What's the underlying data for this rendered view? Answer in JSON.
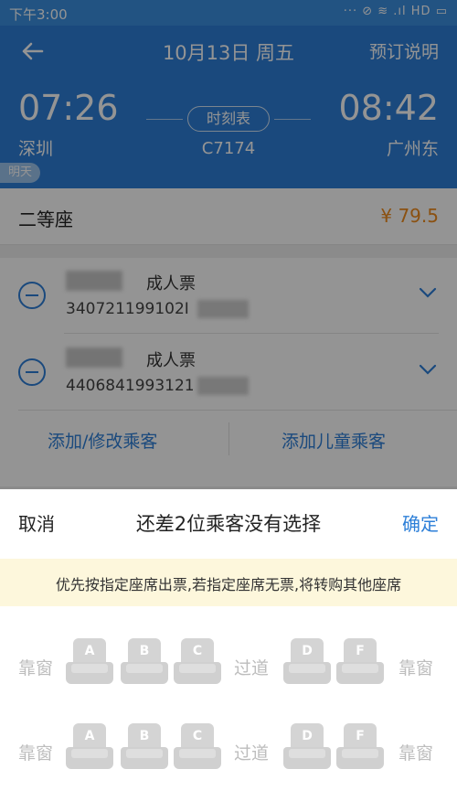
{
  "status_bar": {
    "time": "下午3:00",
    "icons": "··· ⊘ ≋ .ıl HD ▭"
  },
  "header": {
    "date": "10月13日 周五",
    "booking_info": "预订说明",
    "departure_time": "07:26",
    "arrival_time": "08:42",
    "departure_station": "深圳",
    "arrival_station": "广州东",
    "timetable_label": "时刻表",
    "train_number": "C7174",
    "tomorrow_badge": "明天"
  },
  "seat_class": {
    "name": "二等座",
    "price": "¥ 79.5"
  },
  "passengers": [
    {
      "ticket_type": "成人票",
      "id_number_visible": "340721199102I"
    },
    {
      "ticket_type": "成人票",
      "id_number_visible": "4406841993121"
    }
  ],
  "passenger_actions": {
    "add_modify": "添加/修改乘客",
    "add_child": "添加儿童乘客"
  },
  "sheet": {
    "cancel": "取消",
    "title": "还差2位乘客没有选择",
    "confirm": "确定",
    "notice": "优先按指定座席出票,若指定座席无票,将转购其他座席",
    "window_label": "靠窗",
    "aisle_label": "过道",
    "seat_letters": [
      "A",
      "B",
      "C",
      "D",
      "F"
    ]
  },
  "colors": {
    "accent": "#2d7fd8",
    "price": "#f08c1e",
    "notice_bg": "#fdf7dc",
    "seat_disabled": "#d0d0d0"
  }
}
